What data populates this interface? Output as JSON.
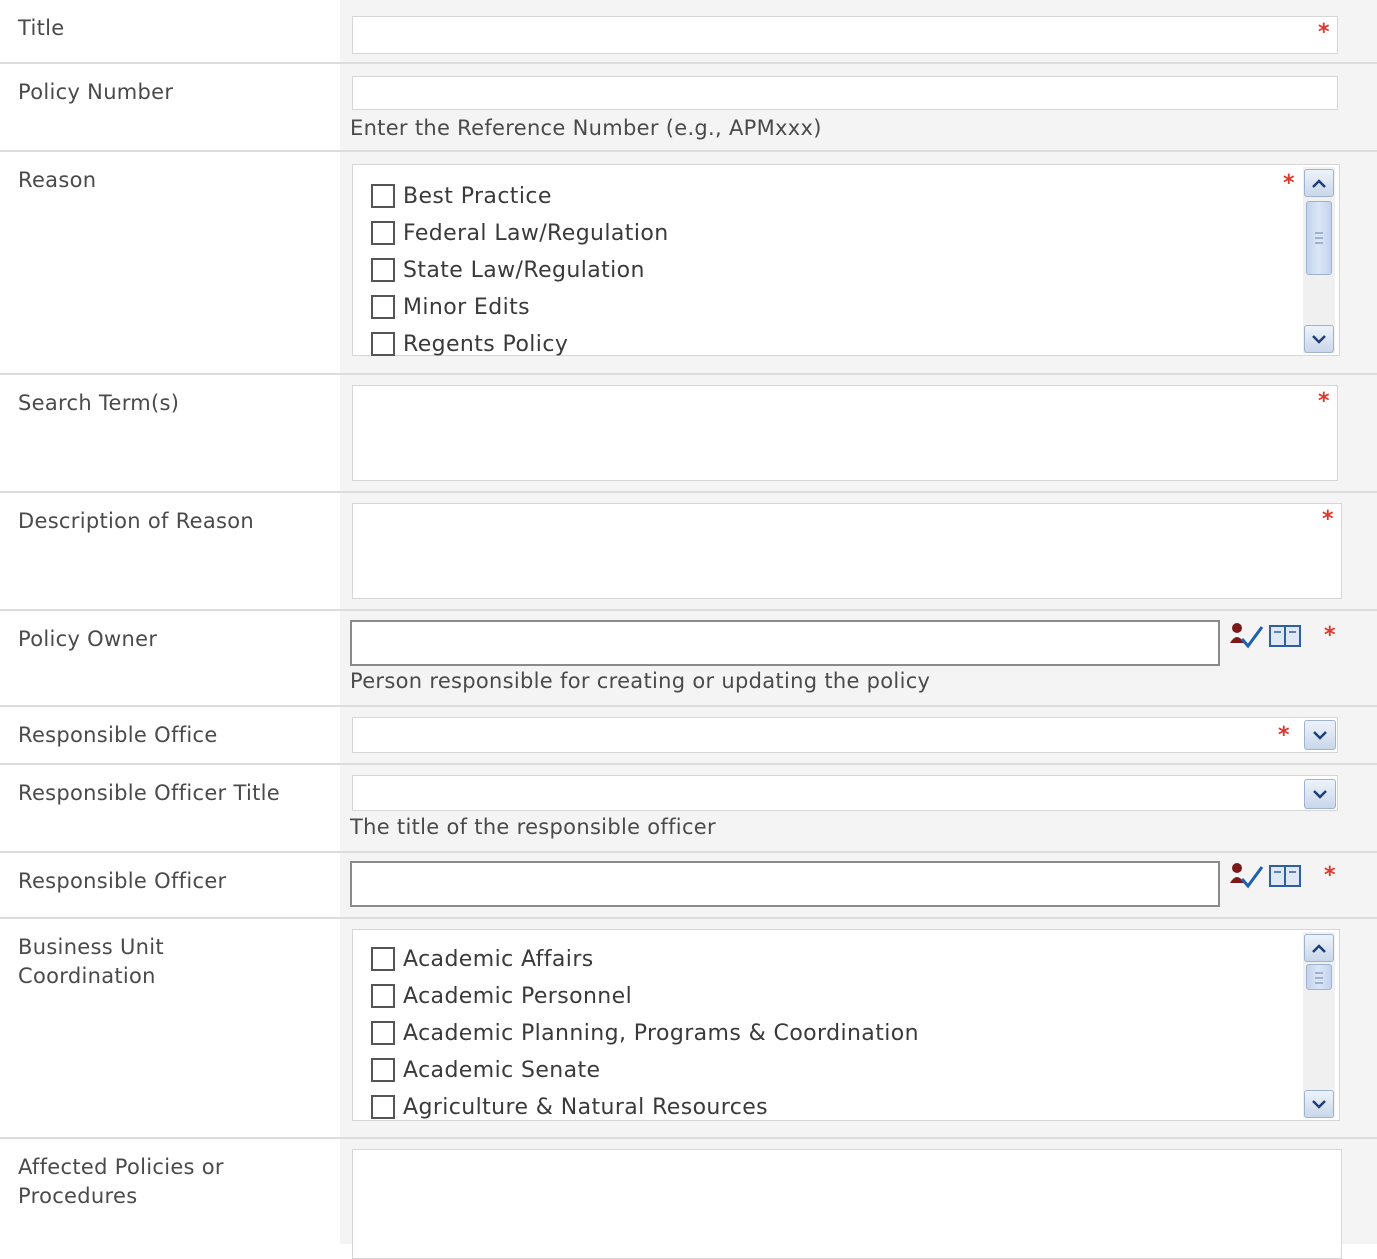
{
  "form": {
    "required_marker": "*",
    "fields": {
      "title": {
        "label": "Title"
      },
      "policy_number": {
        "label": "Policy Number",
        "hint": "Enter the Reference Number (e.g., APMxxx)"
      },
      "reason": {
        "label": "Reason",
        "options": [
          "Best Practice",
          "Federal Law/Regulation",
          "State Law/Regulation",
          "Minor Edits",
          "Regents Policy"
        ]
      },
      "search_terms": {
        "label": "Search Term(s)"
      },
      "description_of_reason": {
        "label": "Description of Reason"
      },
      "policy_owner": {
        "label": "Policy Owner",
        "hint": "Person responsible for creating or updating the policy"
      },
      "responsible_office": {
        "label": "Responsible Office"
      },
      "responsible_officer_title": {
        "label": "Responsible Officer Title",
        "hint": "The title of the responsible officer"
      },
      "responsible_officer": {
        "label": "Responsible Officer"
      },
      "business_unit_coordination": {
        "label": "Business Unit Coordination",
        "options": [
          "Academic Affairs",
          "Academic Personnel",
          "Academic Planning, Programs & Coordination",
          "Academic Senate",
          "Agriculture & Natural Resources"
        ]
      },
      "affected_policies": {
        "label": "Affected Policies or Procedures"
      }
    }
  },
  "colors": {
    "required": "#e0362c",
    "field_bg": "#f4f4f4",
    "scroll_accent": "#9fb3cf"
  },
  "icons": {
    "check_names": "check-names-icon",
    "browse": "address-book-icon",
    "scroll_up": "chevron-up-icon",
    "scroll_down": "chevron-down-icon"
  }
}
